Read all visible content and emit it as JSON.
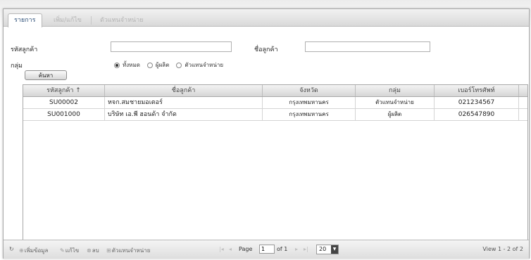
{
  "tabs": [
    {
      "label": "รายการ",
      "active": true
    },
    {
      "label": "เพิ่ม/แก้ไข",
      "active": false
    },
    {
      "label": "ตัวแทนจำหน่าย",
      "active": false
    }
  ],
  "form": {
    "code_label": "รหัสลูกค้า",
    "code_value": "",
    "name_label": "ชื่อลูกค้า",
    "name_value": "",
    "group_label": "กลุ่ม",
    "group_options": [
      "ทั้งหมด",
      "ผู้ผลิต",
      "ตัวแทนจำหน่าย"
    ],
    "group_selected": "ทั้งหมด",
    "search_button": "ค้นหา"
  },
  "grid": {
    "columns": [
      "รหัสลูกค้า ↑",
      "ชื่อลูกค้า",
      "จังหวัด",
      "กลุ่ม",
      "เบอร์โทรศัพท์"
    ],
    "rows": [
      [
        "SU00002",
        "หจก.สมชายมอเตอร์",
        "กรุงเทพมหานคร",
        "ตัวแทนจำหน่าย",
        "021234567"
      ],
      [
        "SU001000",
        "บริษัท เอ.พี ฮอนด้า จำกัด",
        "กรุงเทพมหานคร",
        "ผู้ผลิต",
        "026547890"
      ]
    ]
  },
  "pager": {
    "add_label": "เพิ่มข้อมูล",
    "edit_label": "แก้ไข",
    "delete_label": "ลบ",
    "dealer_label": "ตัวแทนจำหน่าย",
    "page_label": "Page",
    "page_value": "1",
    "of_label": "of 1",
    "page_size": "20",
    "view_text": "View 1 - 2 of 2"
  },
  "colors": {
    "tab_active_text": "#2d4f78",
    "header_bg": "#d6d6d6",
    "border": "#a8a8a8"
  }
}
